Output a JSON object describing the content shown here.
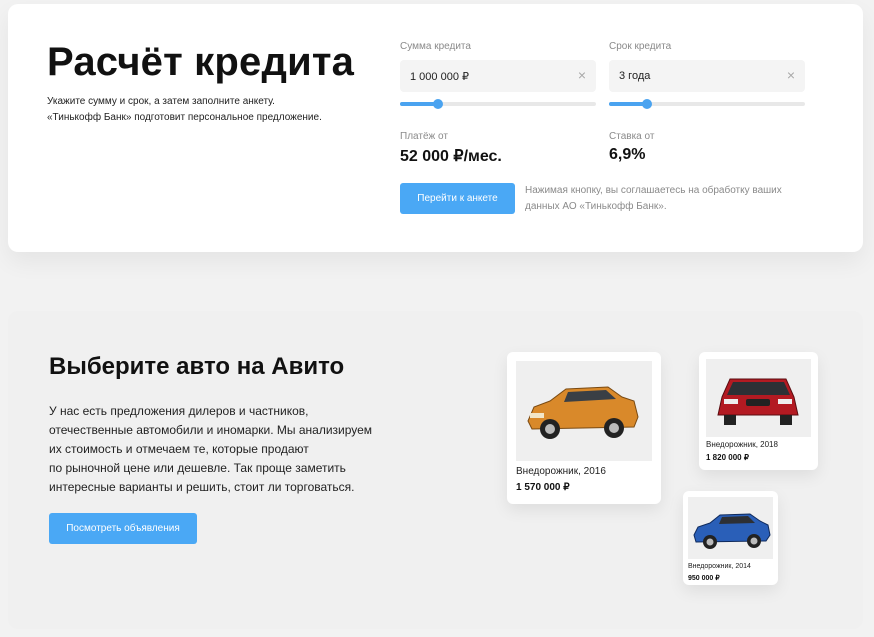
{
  "calculator": {
    "title": "Расчёт кредита",
    "subtitle_line1": "Укажите сумму и срок, а затем заполните анкету.",
    "subtitle_line2": "«Тинькофф Банк» подготовит персональное предложение.",
    "amount": {
      "label": "Сумма кредита",
      "value": "1 000 000 ₽"
    },
    "term": {
      "label": "Срок кредита",
      "value": "3 года"
    },
    "clear_glyph": "×",
    "payment": {
      "label": "Платёж от",
      "value": "52 000 ₽/мес."
    },
    "rate": {
      "label": "Ставка от",
      "value": "6,9%"
    },
    "apply_button": "Перейти к анкете",
    "consent_line1": "Нажимая кнопку, вы соглашаетесь на обработку ваших",
    "consent_line2": "данных АО «Тинькофф Банк».",
    "accent_color": "#4aa8f5"
  },
  "avito": {
    "title": "Выберите авто на Авито",
    "description": [
      "У нас есть предложения дилеров и частников,",
      "отечественные автомобили и иномарки. Мы анализируем",
      "их стоимость и отмечаем те, которые продают",
      "по рыночной цене или дешевле. Так проще заметить",
      "интересные варианты и решить, стоит ли торговаться."
    ],
    "view_button": "Посмотреть объявления",
    "cars": [
      {
        "type": "Внедорожник, 2016",
        "price": "1 570 000 ₽",
        "color": "#d9892a"
      },
      {
        "type": "Внедорожник, 2018",
        "price": "1 820 000 ₽",
        "color": "#b31a22"
      },
      {
        "type": "Внедорожник, 2014",
        "price": "950 000 ₽",
        "color": "#2a5fb8"
      }
    ]
  }
}
